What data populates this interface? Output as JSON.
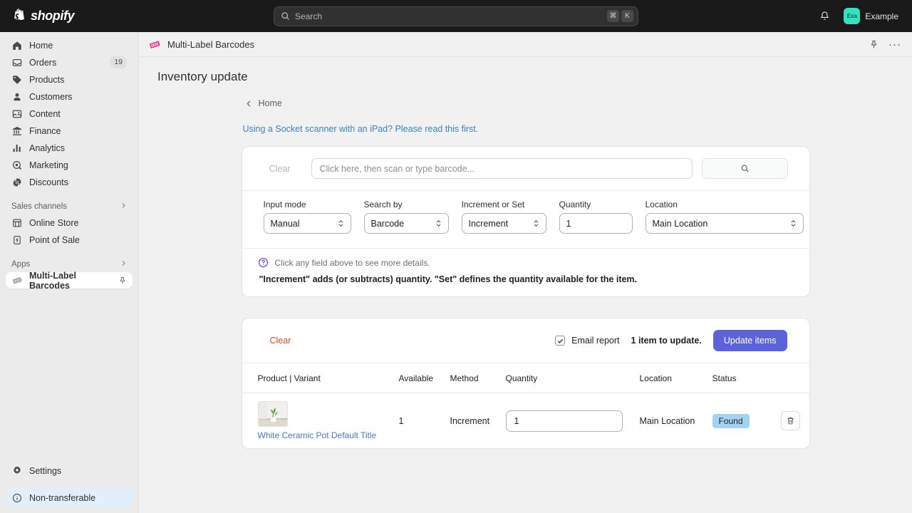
{
  "topbar": {
    "brand": "shopify",
    "search": {
      "placeholder": "Search",
      "kbd_cmd": "⌘",
      "kbd_key": "K"
    },
    "user": {
      "avatar_initials": "Exa",
      "name": "Example"
    }
  },
  "sidebar": {
    "items": [
      {
        "label": "Home",
        "icon": "home-icon"
      },
      {
        "label": "Orders",
        "icon": "orders-icon",
        "badge": "19"
      },
      {
        "label": "Products",
        "icon": "products-icon"
      },
      {
        "label": "Customers",
        "icon": "customers-icon"
      },
      {
        "label": "Content",
        "icon": "content-icon"
      },
      {
        "label": "Finance",
        "icon": "finance-icon"
      },
      {
        "label": "Analytics",
        "icon": "analytics-icon"
      },
      {
        "label": "Marketing",
        "icon": "marketing-icon"
      },
      {
        "label": "Discounts",
        "icon": "discounts-icon"
      }
    ],
    "sales_channels": {
      "label": "Sales channels"
    },
    "channels": [
      {
        "label": "Online Store",
        "icon": "online-store-icon"
      },
      {
        "label": "Point of Sale",
        "icon": "point-of-sale-icon"
      }
    ],
    "apps": {
      "label": "Apps"
    },
    "app_items": [
      {
        "label": "Multi-Label Barcodes",
        "icon": "barcode-label-icon",
        "active": true
      }
    ],
    "settings": {
      "label": "Settings",
      "icon": "gear-icon"
    },
    "non_transferable": {
      "label": "Non-transferable",
      "icon": "info-icon"
    }
  },
  "appbar": {
    "title": "Multi-Label Barcodes",
    "icon": "barcode-label-icon",
    "pin_icon": "pin-icon",
    "more_label": "···"
  },
  "page": {
    "title": "Inventory update",
    "breadcrumb": {
      "label": "Home",
      "icon": "chevron-left-icon"
    },
    "help_link": "Using a Socket scanner with an iPad? Please read this first."
  },
  "scan_card": {
    "clear_label": "Clear",
    "barcode_placeholder": "Click here, then scan or type barcode...",
    "search_button_icon": "search-icon",
    "fields": [
      {
        "label": "Input mode",
        "value": "Manual",
        "type": "select"
      },
      {
        "label": "Search by",
        "value": "Barcode",
        "type": "select"
      },
      {
        "label": "Increment or Set",
        "value": "Increment",
        "type": "select"
      },
      {
        "label": "Quantity",
        "value": "1",
        "type": "text"
      },
      {
        "label": "Location",
        "value": "Main Location",
        "type": "select"
      }
    ],
    "help_icon": "question-mark-icon",
    "help_text": "Click any field above to see more details.",
    "help_bold": "\"Increment\" adds (or subtracts) quantity. \"Set\" defines the quantity available for the item."
  },
  "results_card": {
    "clear_label": "Clear",
    "email_report_label": "Email report",
    "email_report_checked": true,
    "count_text": "1 item to update.",
    "update_button": "Update items",
    "columns": [
      "Product | Variant",
      "Available",
      "Method",
      "Quantity",
      "Location",
      "Status"
    ],
    "rows": [
      {
        "product": "White Ceramic Pot Default Title",
        "available": "1",
        "method": "Increment",
        "quantity": "1",
        "location": "Main Location",
        "status": "Found",
        "delete_icon": "trash-icon"
      }
    ]
  },
  "colors": {
    "accent_primary": "#5c62d8",
    "link": "#3b82c4",
    "clear_red": "#d64d2c",
    "status_badge_bg": "#a4d3f2",
    "avatar_bg": "#36e0c0",
    "app_icon": "#e8348a"
  }
}
